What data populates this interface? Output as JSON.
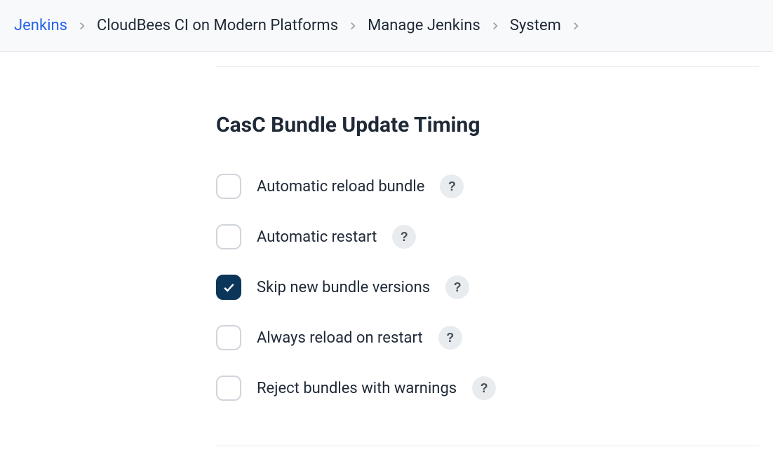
{
  "breadcrumb": {
    "items": [
      {
        "label": "Jenkins"
      },
      {
        "label": "CloudBees CI on Modern Platforms"
      },
      {
        "label": "Manage Jenkins"
      },
      {
        "label": "System"
      }
    ]
  },
  "section": {
    "title": "CasC Bundle Update Timing",
    "help_glyph": "?"
  },
  "options": [
    {
      "label": "Automatic reload bundle",
      "checked": false
    },
    {
      "label": "Automatic restart",
      "checked": false
    },
    {
      "label": "Skip new bundle versions",
      "checked": true
    },
    {
      "label": "Always reload on restart",
      "checked": false
    },
    {
      "label": "Reject bundles with warnings",
      "checked": false
    }
  ]
}
